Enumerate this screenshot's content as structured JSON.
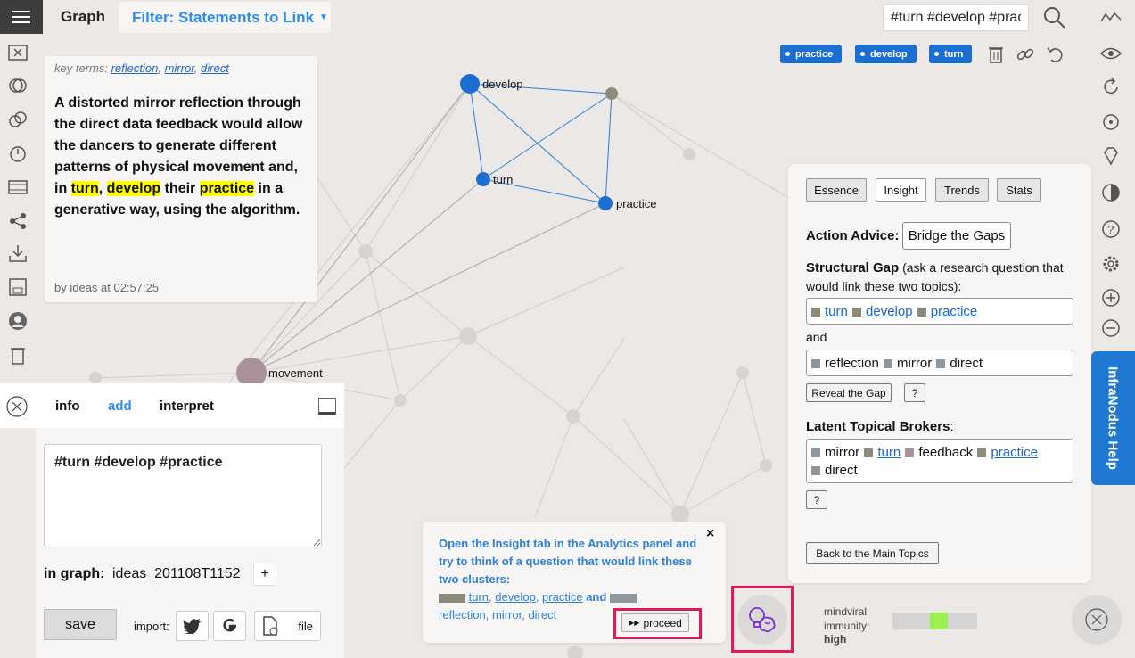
{
  "header": {
    "menu_icon": "hamburger-icon",
    "title": "Graph",
    "filter_label": "Filter: Statements to Link",
    "search_value": "#turn #develop #practice",
    "search_icon": "magnifier-icon"
  },
  "graph": {
    "node_labels": [
      "develop",
      "turn",
      "practice",
      "movement"
    ],
    "accent": "#1c6ed1"
  },
  "tags": [
    "practice",
    "develop",
    "turn"
  ],
  "statement": {
    "key_terms_label": "key terms:",
    "key_terms": [
      "reflection",
      "mirror",
      "direct"
    ],
    "text_parts": [
      "A distorted mirror reflection through the direct data feedback would allow the dancers to generate different patterns of physical movement and, in ",
      "turn",
      ", ",
      "develop",
      " their ",
      "practice",
      " in a generative way, using the algorithm."
    ],
    "byline": "by ideas at 02:57:25"
  },
  "panel": {
    "tabs": [
      "info",
      "add",
      "interpret"
    ],
    "entry": "#turn #develop #practice",
    "in_graph_label": "in graph:",
    "in_graph_value": "ideas_201108T1152",
    "plus": "+",
    "save": "save",
    "import_label": "import:",
    "file_label": "file"
  },
  "popup": {
    "close": "×",
    "line1": "Open the Insight tab in the Analytics panel and try to think of a question that would link these two clusters:",
    "cluster1": [
      "turn",
      "develop",
      "practice"
    ],
    "and": "and",
    "cluster2": [
      "reflection",
      "mirror",
      "direct"
    ],
    "proceed": "proceed"
  },
  "mindviral": {
    "label": "mindviral immunity:",
    "value": "high",
    "level": 0.55
  },
  "analytics": {
    "tabs": [
      "Essence",
      "Insight",
      "Trends",
      "Stats"
    ],
    "active_tab": "Insight",
    "action_label": "Action Advice:",
    "action_value": "Bridge the Gaps",
    "gap_label": "Structural Gap",
    "gap_desc": " (ask a research question that would link these two topics):",
    "gap_a": [
      "turn",
      "develop",
      "practice"
    ],
    "and": "and",
    "gap_b": [
      "reflection",
      "mirror",
      "direct"
    ],
    "reveal": "Reveal the Gap",
    "q": "?",
    "brokers_label": "Latent Topical Brokers",
    "brokers": [
      "mirror",
      "turn",
      "feedback",
      "practice",
      "direct"
    ],
    "back": "Back to the Main Topics"
  },
  "help_tab": "InfraNodus Help",
  "colors": {
    "node_blue": "#1c6ed1",
    "olive": "#8c8b7a",
    "gray_sq": "#8e979e",
    "mauve": "#a9909a",
    "highlight": "#ffff00",
    "mindviral_fill": "#9cf051"
  }
}
